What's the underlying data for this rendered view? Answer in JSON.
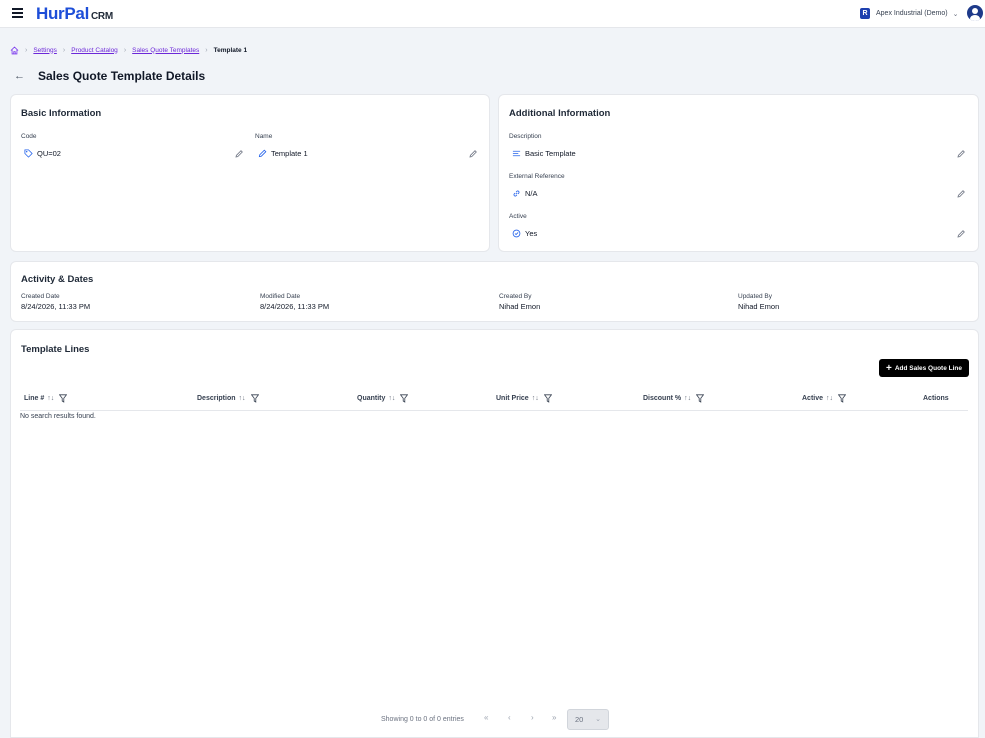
{
  "header": {
    "logo_main": "HurPal",
    "logo_suffix": "CRM",
    "org_badge": "R",
    "org_name": "Apex Industrial (Demo)"
  },
  "breadcrumb": {
    "items": [
      "Settings",
      "Product Catalog",
      "Sales Quote Templates"
    ],
    "current": "Template 1"
  },
  "page": {
    "title": "Sales Quote Template Details"
  },
  "basic_info": {
    "title": "Basic Information",
    "code_label": "Code",
    "code_value": "QU=02",
    "name_label": "Name",
    "name_value": "Template 1"
  },
  "additional_info": {
    "title": "Additional Information",
    "description_label": "Description",
    "description_value": "Basic Template",
    "external_ref_label": "External Reference",
    "external_ref_value": "N/A",
    "active_label": "Active",
    "active_value": "Yes"
  },
  "activity": {
    "title": "Activity & Dates",
    "created_date_label": "Created Date",
    "created_date_value": "8/24/2026, 11:33 PM",
    "modified_date_label": "Modified Date",
    "modified_date_value": "8/24/2026, 11:33 PM",
    "created_by_label": "Created By",
    "created_by_value": "Nihad Emon",
    "updated_by_label": "Updated By",
    "updated_by_value": "Nihad Emon"
  },
  "template_lines": {
    "title": "Template Lines",
    "add_button": "Add Sales Quote Line",
    "columns": {
      "line": "Line #",
      "description": "Description",
      "quantity": "Quantity",
      "unit_price": "Unit Price",
      "discount": "Discount %",
      "active": "Active",
      "actions": "Actions"
    },
    "empty_message": "No search results found.",
    "pagination_text": "Showing 0 to 0 of 0 entries",
    "page_size": "20"
  },
  "colors": {
    "brand": "#1d4ed8",
    "link": "#6d28d9",
    "icon_accent": "#2563eb"
  }
}
